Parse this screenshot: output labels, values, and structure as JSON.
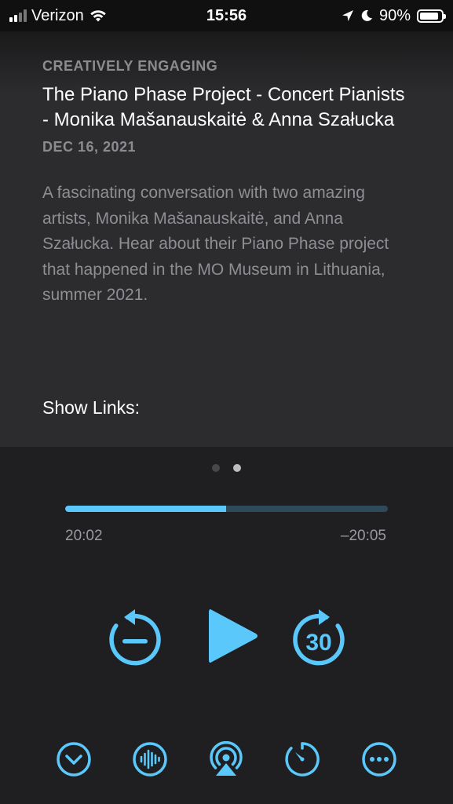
{
  "status_bar": {
    "carrier": "Verizon",
    "time": "15:56",
    "battery": "90%",
    "battery_level": 0.9
  },
  "episode": {
    "podcast_name": "CREATIVELY ENGAGING",
    "title": "The Piano Phase Project - Concert Pianists - Monika Mašanauskaitė & Anna Szałucka",
    "date": "DEC 16, 2021",
    "description": "A fascinating conversation with two amazing artists, Monika Mašanauskaitė, and Anna Szałucka. Hear about their Piano Phase project that happened in the MO Museum in Lithuania, summer 2021.",
    "show_links_label": "Show Links:"
  },
  "player": {
    "page_count": 2,
    "active_page": 1,
    "progress": 0.4995,
    "elapsed": "20:02",
    "remaining": "–20:05",
    "skip_forward_label": "30",
    "accent_color": "#5ac8fa"
  },
  "icons": {
    "skip_back": "skip-back-icon",
    "play": "play-icon",
    "skip_forward": "skip-forward-30-icon",
    "collapse": "chevron-down-icon",
    "audio": "waveform-icon",
    "airplay": "airplay-icon",
    "sleep_timer": "timer-icon",
    "more": "more-icon"
  }
}
